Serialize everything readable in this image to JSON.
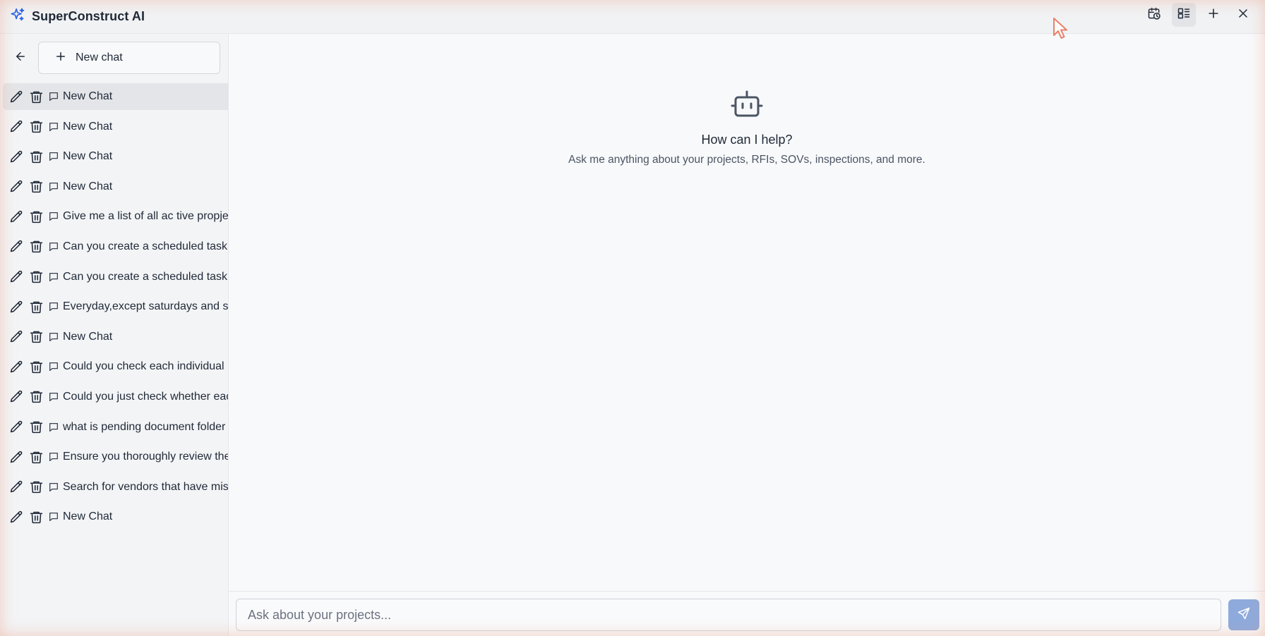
{
  "app": {
    "title": "SuperConstruct AI",
    "brand_icon": "sparkle-icon"
  },
  "top_actions": [
    {
      "name": "scheduled-tasks-button",
      "icon": "calendar-clock-icon",
      "active": false
    },
    {
      "name": "chat-list-toggle-button",
      "icon": "list-layout-icon",
      "active": true
    },
    {
      "name": "add-button",
      "icon": "plus-icon",
      "active": false
    },
    {
      "name": "close-button",
      "icon": "close-icon",
      "active": false
    }
  ],
  "sidebar": {
    "back_icon": "arrow-left-icon",
    "new_chat_label": "New chat",
    "chats": [
      {
        "label": "New Chat",
        "selected": true
      },
      {
        "label": "New Chat"
      },
      {
        "label": "New Chat"
      },
      {
        "label": "New Chat"
      },
      {
        "label": "Give me a list of all ac tive propjects"
      },
      {
        "label": "Can you create a scheduled task"
      },
      {
        "label": "Can you create a scheduled task"
      },
      {
        "label": "Everyday,except saturdays and sundays"
      },
      {
        "label": "New Chat"
      },
      {
        "label": "Could you check each individual"
      },
      {
        "label": "Could you just check whether each"
      },
      {
        "label": "what is pending document folder"
      },
      {
        "label": "Ensure you thoroughly review the"
      },
      {
        "label": "Search for vendors that have missing"
      },
      {
        "label": "New Chat"
      }
    ]
  },
  "main": {
    "icon": "robot-icon",
    "title": "How can I help?",
    "subtitle": "Ask me anything about your projects, RFIs, SOVs, inspections, and more."
  },
  "composer": {
    "placeholder": "Ask about your projects...",
    "value": "",
    "send_icon": "send-icon"
  },
  "colors": {
    "accent": "#2563eb",
    "send_button": "#8eaadc",
    "selected_item": "#e4e5e8",
    "sidebar_bg": "#f3f4f6"
  }
}
